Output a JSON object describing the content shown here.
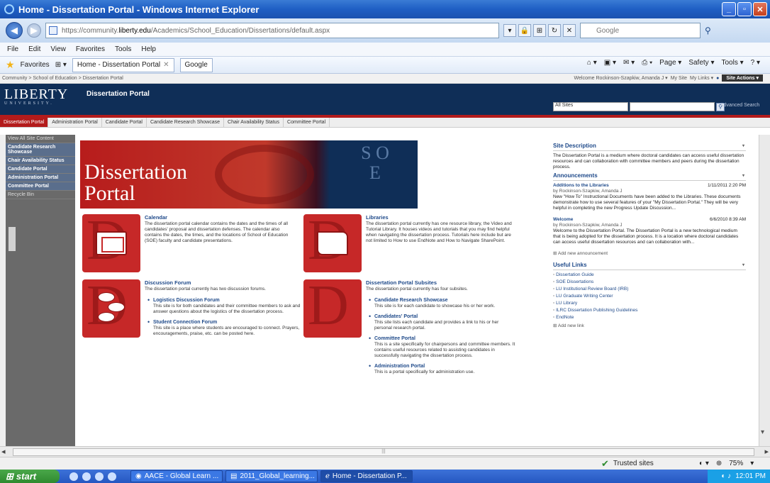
{
  "window": {
    "title": "Home - Dissertation Portal - Windows Internet Explorer"
  },
  "address": {
    "url_prefix": "https://community.",
    "url_domain": "liberty.edu",
    "url_path": "/Academics/School_Education/Dissertations/default.aspx",
    "search_placeholder": "Google"
  },
  "menu": [
    "File",
    "Edit",
    "View",
    "Favorites",
    "Tools",
    "Help"
  ],
  "favorites": {
    "label": "Favorites",
    "tab1": "Home - Dissertation Portal",
    "tab2": "Google"
  },
  "commands": [
    "Page ▾",
    "Safety ▾",
    "Tools ▾"
  ],
  "sp": {
    "breadcrumb": "Community > School of Education > Dissertation Portal",
    "welcome": "Welcome Rockinson-Szapkiw, Amanda J ▾",
    "mysite": "My Site",
    "mylinks": "My Links ▾",
    "site_actions": "Site Actions ▾",
    "logo": "LIBERTY",
    "logo_sub": "UNIVERSITY.",
    "portal_title": "Dissertation Portal",
    "search_scope": "All Sites",
    "advanced": "Advanced Search",
    "topnav": [
      "Dissertation Portal",
      "Administration Portal",
      "Candidate Portal",
      "Candidate Research Showcase",
      "Chair Availability Status",
      "Committee Portal"
    ],
    "quicklaunch": [
      "View All Site Content",
      "Candidate Research Showcase",
      "Chair Availability Status",
      "Candidate Portal",
      "Administration Portal",
      "Committee Portal",
      "Recycle Bin"
    ],
    "hero_line1": "Dissertation",
    "hero_line2": "Portal",
    "hero_soe": "S O E",
    "calendar": {
      "title": "Calendar",
      "text": "The dissertation portal calendar contains the dates and the times of all candidates' proposal and dissertation defenses. The calendar also contains the dates, the times, and the locations of School of Education (SOE) faculty and candidate presentations."
    },
    "libraries": {
      "title": "Libraries",
      "text": "The dissertation portal currently has one resource library, the Video and Tutorial Library. It houses videos and tutorials that you may find helpful when navigating the dissertation process. Tutorials here include but are not limited to How to use EndNote and How to Navigate SharePoint."
    },
    "forum": {
      "title": "Discussion Forum",
      "text": "The dissertation portal currently has two discussion forums.",
      "items": [
        {
          "name": "Logistics Discussion Forum",
          "desc": "This site is for both candidates and their committee members to ask and answer questions about the logistics of the dissertation process."
        },
        {
          "name": "Student Connection Forum",
          "desc": "This site is a place where students are encouraged to connect. Prayers, encouragements, praise, etc. can be posted here."
        }
      ]
    },
    "subsites": {
      "title": "Dissertation Portal Subsites",
      "text": "The dissertation portal currently has four subsites.",
      "items": [
        {
          "name": "Candidate Research Showcase",
          "desc": "This site is for each candidate to showcase his or her work."
        },
        {
          "name": "Candidates' Portal",
          "desc": "This site lists each candidate and provides a link to his or her personal research portal."
        },
        {
          "name": "Committee Portal",
          "desc": "This is a site specifically for chairpersons and committee members. It contains useful resources related to assisting candidates in successfully navigating the dissertation process."
        },
        {
          "name": "Administration Portal",
          "desc": "This is a portal specifically for administration use."
        }
      ]
    },
    "site_desc": {
      "title": "Site Description",
      "text": "The Dissertation Portal is a medium where doctoral candidates can access useful dissertation resources and can collaboration with committee members and peers during the dissertation process."
    },
    "announcements": {
      "title": "Announcements",
      "items": [
        {
          "title": "Additions to the Libraries",
          "date": "1/11/2011 2:20 PM",
          "by": "by Rockinson-Szapkiw, Amanda J",
          "text": "New \"How To\" Instructional Documents have been added to the Libraries. These documents demonstrate how to use several features of your \"My Dissertation Portal.\" They will be very helpful in completing the new Progress Update Discussion..."
        },
        {
          "title": "Welcome",
          "date": "6/6/2010 8:39 AM",
          "by": "by Rockinson-Szapkiw, Amanda J",
          "text": "Welcome to the Dissertation Portal. The Dissertation Portal is a new technological medium that is being adopted for the dissertation process. It is a location where doctoral candidates can access useful dissertation resources and can collaboration with..."
        }
      ],
      "add": "Add new announcement"
    },
    "links": {
      "title": "Useful Links",
      "items": [
        "Dissertation Guide",
        "SOE Dissertations",
        "LU Institutional Review Board (IRB)",
        "LU Graduate Writing Center",
        "LU Library",
        "ILRC Dissertation Publishing Guidelines",
        "EndNote"
      ],
      "add": "Add new link"
    }
  },
  "status": {
    "zone": "Trusted sites",
    "zoom": "75%"
  },
  "taskbar": {
    "start": "start",
    "tasks": [
      "AACE - Global Learn ...",
      "2011_Global_learning...",
      "Home - Dissertation P..."
    ],
    "time": "12:01 PM"
  }
}
